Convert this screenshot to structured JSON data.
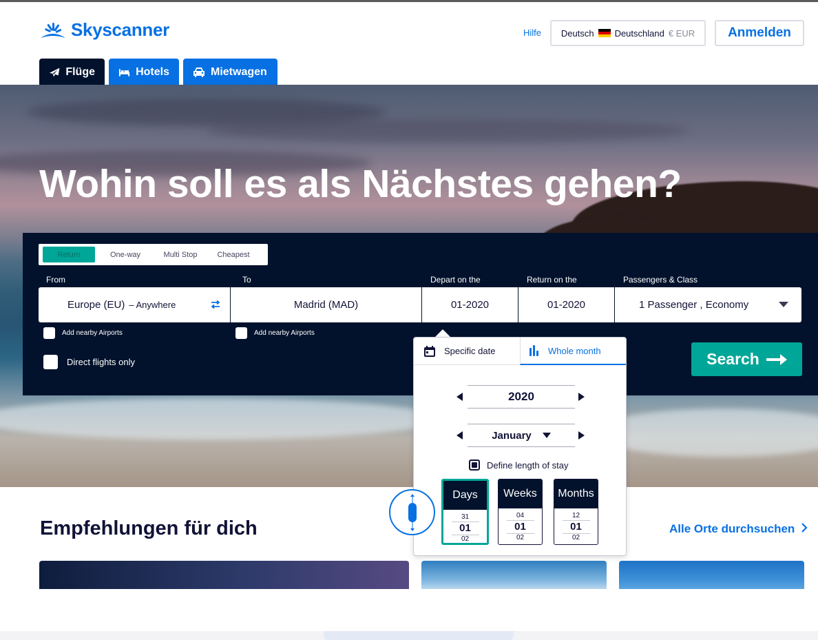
{
  "header": {
    "brand": "Skyscanner",
    "help_label": "Hilfe",
    "locale": {
      "language": "Deutsch",
      "country": "Deutschland",
      "currency": "€ EUR"
    },
    "login_label": "Anmelden"
  },
  "tabs": [
    {
      "label": "Flüge",
      "icon": "plane-icon",
      "active": true
    },
    {
      "label": "Hotels",
      "icon": "bed-icon",
      "active": false
    },
    {
      "label": "Mietwagen",
      "icon": "car-icon",
      "active": false
    }
  ],
  "hero": {
    "headline": "Wohin soll es als Nächstes gehen?"
  },
  "search": {
    "trip_types": [
      "Return",
      "One-way",
      "Multi Stop",
      "Cheapest"
    ],
    "active_trip_type": "Return",
    "labels": {
      "from": "From",
      "to": "To",
      "depart": "Depart on the",
      "return": "Return on the",
      "passengers": "Passengers & Class"
    },
    "from_value": "Europe (EU)",
    "from_suffix": "– Anywhere",
    "to_value": "Madrid (MAD)",
    "depart_value": "01-2020",
    "return_value": "01-2020",
    "passengers_value": "1 Passenger , Economy",
    "nearby_from_label": "Add nearby Airports",
    "nearby_to_label": "Add nearby Airports",
    "direct_label": "Direct flights only",
    "search_label": "Search"
  },
  "date_picker": {
    "tab_specific": "Specific date",
    "tab_whole": "Whole month",
    "active_tab": "Whole month",
    "year": "2020",
    "month": "January",
    "define_stay_label": "Define length of stay",
    "define_stay_checked": true,
    "units": [
      {
        "label": "Days",
        "prev": "31",
        "current": "01",
        "next": "02",
        "active": true
      },
      {
        "label": "Weeks",
        "prev": "04",
        "current": "01",
        "next": "02",
        "active": false
      },
      {
        "label": "Months",
        "prev": "12",
        "current": "01",
        "next": "02",
        "active": false
      }
    ]
  },
  "recommendations": {
    "title": "Empfehlungen für dich",
    "browse_link": "Alle Orte durchsuchen"
  },
  "colors": {
    "brand_blue": "#0770e3",
    "navy": "#02122c",
    "teal": "#00a698"
  }
}
